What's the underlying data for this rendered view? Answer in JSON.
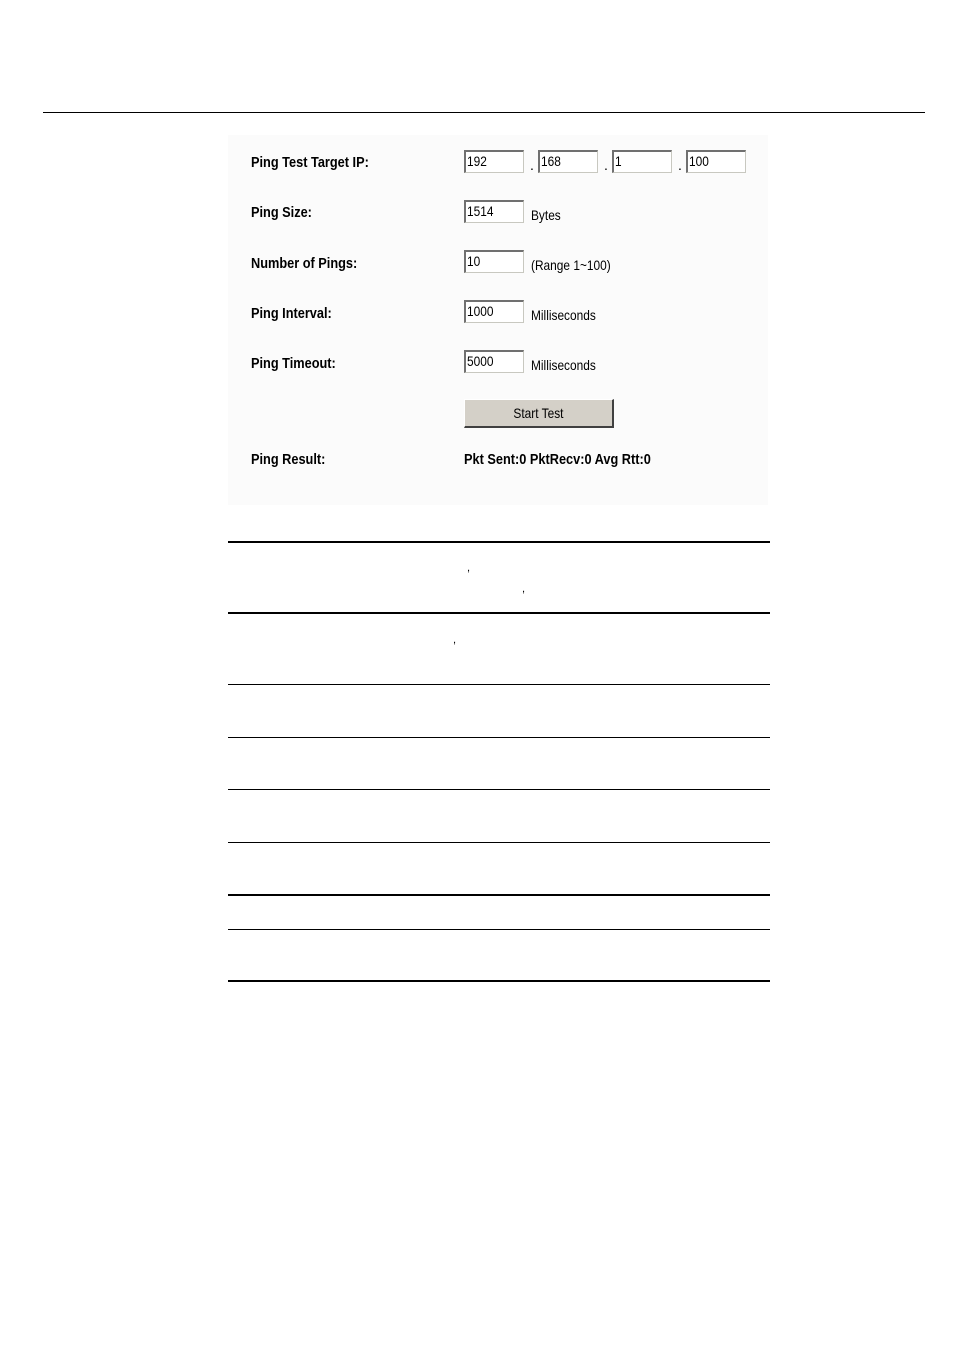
{
  "form": {
    "target_ip": {
      "label": "Ping Test Target IP:",
      "octets": [
        "192",
        "168",
        "1",
        "100"
      ],
      "separator": "."
    },
    "ping_size": {
      "label": "Ping Size:",
      "value": "1514",
      "unit": "Bytes"
    },
    "num_pings": {
      "label": "Number of Pings:",
      "value": "10",
      "unit": "(Range 1~100)"
    },
    "interval": {
      "label": "Ping Interval:",
      "value": "1000",
      "unit": "Milliseconds"
    },
    "timeout": {
      "label": "Ping Timeout:",
      "value": "5000",
      "unit": "Milliseconds"
    },
    "start_button": "Start Test",
    "result": {
      "label": "Ping Result:",
      "value": "Pkt Sent:0 PktRecv:0 Avg Rtt:0"
    }
  },
  "table": {
    "commas": [
      ",",
      ",",
      ","
    ]
  }
}
